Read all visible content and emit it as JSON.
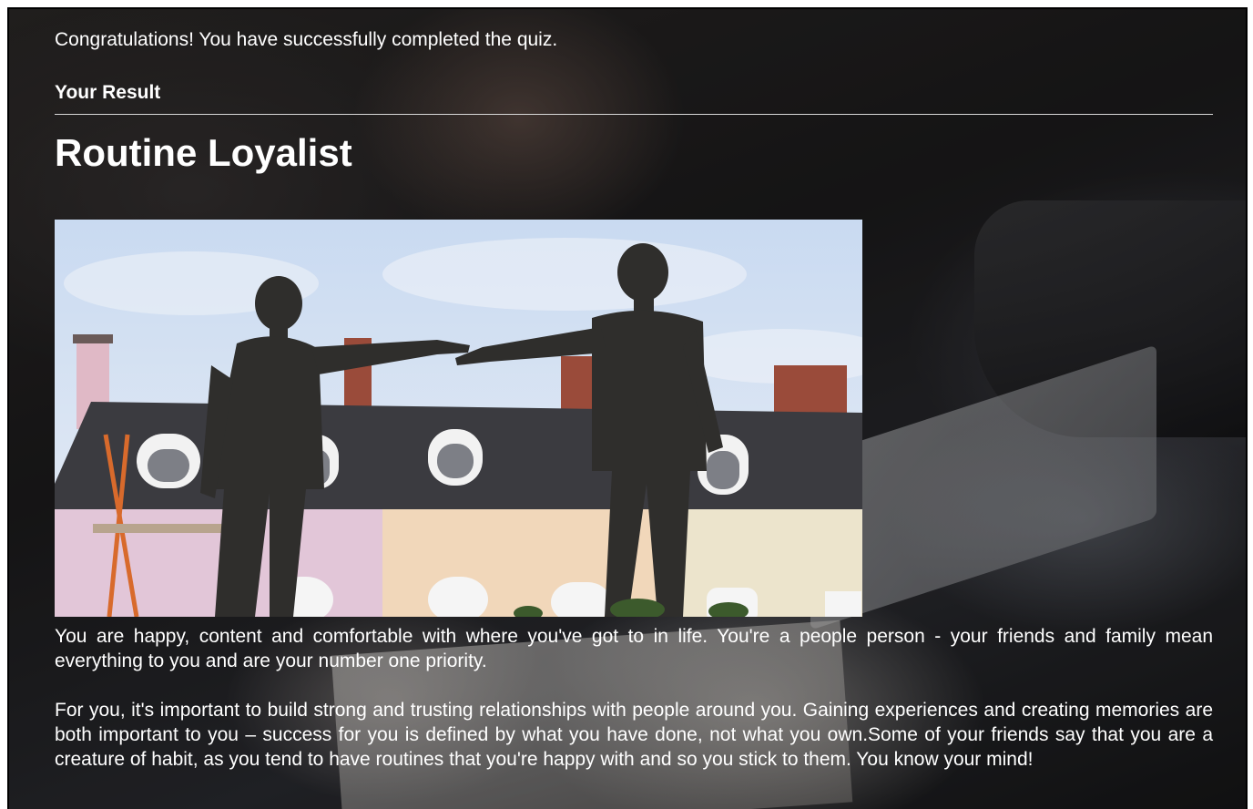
{
  "quiz": {
    "completion_message": "Congratulations! You have successfully completed the quiz.",
    "result_label": "Your Result",
    "result_title": "Routine Loyalist",
    "image_description": "Statue of two men reaching toward each other in front of pastel terraced houses",
    "paragraphs": [
      "You are happy, content and comfortable with where you've got to in life. You're a people person - your friends and family mean everything to you and are your number one priority.",
      "For you, it's important to build strong and trusting relationships with people around you. Gaining experiences and creating memories are both important to you – success for you is defined by what you have done, not what you own.Some of your friends say that you are a creature of habit, as you tend to have routines that you're happy with and so you stick to them. You know your mind!"
    ]
  },
  "colors": {
    "text": "#ffffff",
    "rule": "#d8d8d8",
    "sky": "#c9daf1",
    "roof": "#3b3b40",
    "house_pink": "#e2c6d8",
    "house_peach": "#f1d7ba",
    "house_cream": "#ece4cc",
    "brick": "#9a4b3a",
    "bronze": "#2f2e2c"
  }
}
